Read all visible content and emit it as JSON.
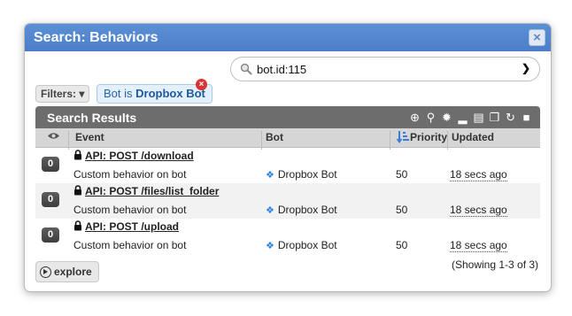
{
  "dialog": {
    "title": "Search: Behaviors",
    "close_label": "×"
  },
  "search": {
    "value": "bot.id:115"
  },
  "filters": {
    "button_label": "Filters:",
    "chip_prefix": "Bot is",
    "chip_value": "Dropbox Bot"
  },
  "results": {
    "title": "Search Results",
    "columns": {
      "event": "Event",
      "bot": "Bot",
      "priority": "Priority",
      "updated": "Updated"
    },
    "rows": [
      {
        "count": "0",
        "event": "API: POST /download",
        "description": "Custom behavior on bot",
        "bot": "Dropbox Bot",
        "priority": "50",
        "updated": "18 secs ago"
      },
      {
        "count": "0",
        "event": "API: POST /files/list_folder",
        "description": "Custom behavior on bot",
        "bot": "Dropbox Bot",
        "priority": "50",
        "updated": "18 secs ago"
      },
      {
        "count": "0",
        "event": "API: POST /upload",
        "description": "Custom behavior on bot",
        "bot": "Dropbox Bot",
        "priority": "50",
        "updated": "18 secs ago"
      }
    ]
  },
  "footer": {
    "explore_label": "explore",
    "showing": "(Showing 1-3 of 3)"
  },
  "colors": {
    "titlebar": "#4a7ec8",
    "results_bar": "#6d6d6d",
    "chip_remove": "#d93333",
    "dropbox": "#2a7fe0"
  },
  "icons": [
    "close-icon",
    "magnifier-icon",
    "chevron-down-icon",
    "remove-filter-icon",
    "add-icon",
    "search-icon",
    "gear-icon",
    "signal-icon",
    "export-icon",
    "copy-icon",
    "refresh-icon",
    "checkbox-icon",
    "eye-icon",
    "lock-icon",
    "dropbox-icon",
    "sort-icon",
    "play-icon"
  ]
}
